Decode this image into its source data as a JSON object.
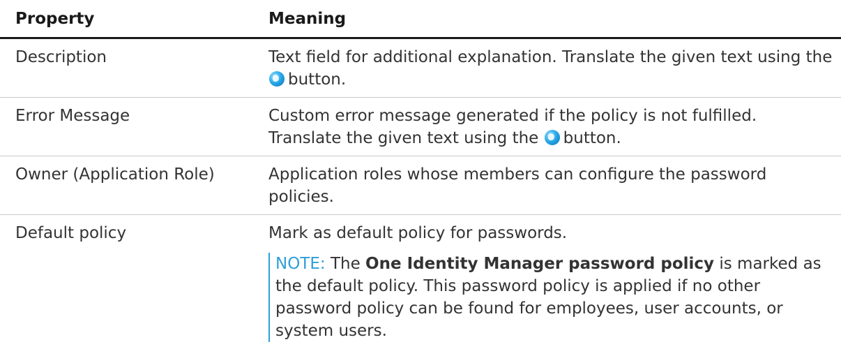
{
  "table": {
    "headers": [
      "Property",
      "Meaning"
    ],
    "rows": [
      {
        "property": "Description",
        "meaning_before": "Text field for additional explanation. Translate the given text using the",
        "meaning_after": "button.",
        "icon": "globe-icon"
      },
      {
        "property": "Error Message",
        "meaning_before": "Custom error message generated if the policy is not fulfilled. Translate the given text using the",
        "meaning_after": "button.",
        "icon": "globe-icon"
      },
      {
        "property": "Owner (Application Role)",
        "meaning": "Application roles whose members can configure the password policies."
      },
      {
        "property": "Default policy",
        "meaning": "Mark as default policy for passwords.",
        "note": {
          "label": "NOTE:",
          "text_before": "The",
          "strong": "One Identity Manager password policy",
          "text_after": "is marked as the default policy. This password policy is applied if no other password policy can be found for employees, user accounts, or system users."
        }
      }
    ]
  },
  "colors": {
    "note_accent": "#2e9fd8",
    "text": "#333333",
    "header_rule": "#1a1a1a",
    "row_rule": "#c8c8c8"
  }
}
